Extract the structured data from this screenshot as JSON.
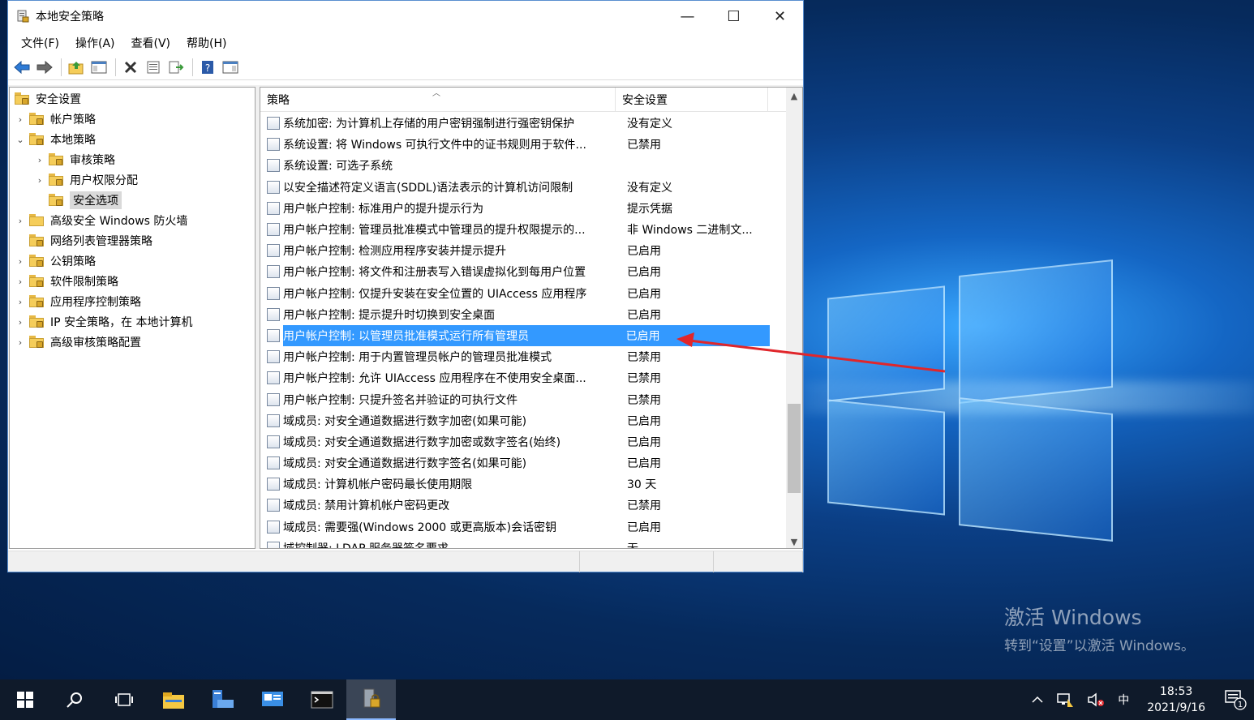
{
  "window": {
    "title": "本地安全策略",
    "controls": {
      "minimize": "—",
      "maximize": "☐",
      "close": "✕"
    }
  },
  "menu": [
    "文件(F)",
    "操作(A)",
    "查看(V)",
    "帮助(H)"
  ],
  "toolbar": {
    "icons": [
      "back-icon",
      "forward-icon",
      "up-folder-icon",
      "show-hide-tree-icon",
      "delete-icon",
      "properties-icon",
      "export-list-icon",
      "help-icon",
      "action-pane-icon"
    ]
  },
  "tree": {
    "items": [
      {
        "label": "安全设置",
        "level": 0,
        "arrow": ""
      },
      {
        "label": "帐户策略",
        "level": 1,
        "arrow": "›"
      },
      {
        "label": "本地策略",
        "level": 1,
        "arrow": "⌄"
      },
      {
        "label": "审核策略",
        "level": 2,
        "arrow": "›"
      },
      {
        "label": "用户权限分配",
        "level": 2,
        "arrow": "›"
      },
      {
        "label": "安全选项",
        "level": 2,
        "arrow": "",
        "selected": true
      },
      {
        "label": "高级安全 Windows 防火墙",
        "level": 1,
        "arrow": "›"
      },
      {
        "label": "网络列表管理器策略",
        "level": 1,
        "arrow": ""
      },
      {
        "label": "公钥策略",
        "level": 1,
        "arrow": "›"
      },
      {
        "label": "软件限制策略",
        "level": 1,
        "arrow": "›"
      },
      {
        "label": "应用程序控制策略",
        "level": 1,
        "arrow": "›"
      },
      {
        "label": "IP 安全策略，在 本地计算机",
        "level": 1,
        "arrow": "›"
      },
      {
        "label": "高级审核策略配置",
        "level": 1,
        "arrow": "›"
      }
    ]
  },
  "list": {
    "headers": {
      "policy": "策略",
      "setting": "安全设置"
    },
    "rows": [
      {
        "policy": "系统加密: 为计算机上存储的用户密钥强制进行强密钥保护",
        "setting": "没有定义"
      },
      {
        "policy": "系统设置: 将 Windows 可执行文件中的证书规则用于软件...",
        "setting": "已禁用"
      },
      {
        "policy": "系统设置: 可选子系统",
        "setting": ""
      },
      {
        "policy": "以安全描述符定义语言(SDDL)语法表示的计算机访问限制",
        "setting": "没有定义"
      },
      {
        "policy": "用户帐户控制: 标准用户的提升提示行为",
        "setting": "提示凭据"
      },
      {
        "policy": "用户帐户控制: 管理员批准模式中管理员的提升权限提示的...",
        "setting": "非 Windows 二进制文..."
      },
      {
        "policy": "用户帐户控制: 检测应用程序安装并提示提升",
        "setting": "已启用"
      },
      {
        "policy": "用户帐户控制: 将文件和注册表写入错误虚拟化到每用户位置",
        "setting": "已启用"
      },
      {
        "policy": "用户帐户控制: 仅提升安装在安全位置的 UIAccess 应用程序",
        "setting": "已启用"
      },
      {
        "policy": "用户帐户控制: 提示提升时切换到安全桌面",
        "setting": "已启用"
      },
      {
        "policy": "用户帐户控制: 以管理员批准模式运行所有管理员",
        "setting": "已启用",
        "selected": true
      },
      {
        "policy": "用户帐户控制: 用于内置管理员帐户的管理员批准模式",
        "setting": "已禁用"
      },
      {
        "policy": "用户帐户控制: 允许 UIAccess 应用程序在不使用安全桌面...",
        "setting": "已禁用"
      },
      {
        "policy": "用户帐户控制: 只提升签名并验证的可执行文件",
        "setting": "已禁用"
      },
      {
        "policy": "域成员: 对安全通道数据进行数字加密(如果可能)",
        "setting": "已启用"
      },
      {
        "policy": "域成员: 对安全通道数据进行数字加密或数字签名(始终)",
        "setting": "已启用"
      },
      {
        "policy": "域成员: 对安全通道数据进行数字签名(如果可能)",
        "setting": "已启用"
      },
      {
        "policy": "域成员: 计算机帐户密码最长使用期限",
        "setting": "30 天"
      },
      {
        "policy": "域成员: 禁用计算机帐户密码更改",
        "setting": "已禁用"
      },
      {
        "policy": "域成员: 需要强(Windows 2000 或更高版本)会话密钥",
        "setting": "已启用"
      },
      {
        "policy": "域控制器: LDAP 服务器签名要求",
        "setting": "无"
      }
    ]
  },
  "desktop": {
    "activate_title": "激活 Windows",
    "activate_sub": "转到“设置”以激活 Windows。"
  },
  "taskbar": {
    "apps": [
      "start-icon",
      "search-icon",
      "task-view-icon",
      "file-explorer-icon",
      "server-manager-icon",
      "control-panel-icon",
      "cmd-icon",
      "local-security-policy-icon"
    ],
    "tray": {
      "ime": "中",
      "time": "18:53",
      "date": "2021/9/16",
      "notification_count": "1"
    }
  },
  "colors": {
    "selection": "#3399ff",
    "annotation_arrow": "#e0262b"
  }
}
